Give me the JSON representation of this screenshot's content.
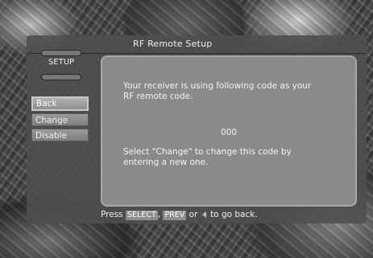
{
  "window": {
    "title": "RF Remote Setup",
    "section_label": "SETUP"
  },
  "menu": {
    "items": [
      {
        "label": "Back",
        "selected": true
      },
      {
        "label": "Change",
        "selected": false
      },
      {
        "label": "Disable",
        "selected": false
      }
    ]
  },
  "content": {
    "message": "Your receiver is using following code as your\nRF remote code.",
    "code": "000",
    "instruction": "Select \"Change\" to change this code by\nentering a new one."
  },
  "footer": {
    "prefix": "Press",
    "key_select": "SELECT",
    "separator": ",",
    "key_prev": "PREV",
    "or": "or",
    "suffix": "to go back.",
    "arrow_icon": "left-arrow-icon"
  },
  "colors": {
    "panel": "#4e4e4e",
    "content_box": "#8a8a8a",
    "button": "#8e8e8e",
    "text": "#f0f0f0"
  }
}
